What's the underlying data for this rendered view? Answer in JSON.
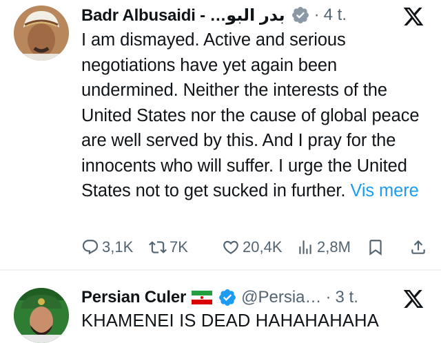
{
  "tweets": [
    {
      "author": "Badr Albusaidi - …بدر البو",
      "time": "4 t.",
      "text": "I am dismayed. Active and serious negotiations have yet again been undermined. Neither the interests of the United States nor the cause of global peace are well served by this. And I pray for the innocents who will suffer. I urge the United States not to get sucked in further.",
      "more_label": "Vis mere",
      "stats": {
        "replies": "3,1K",
        "reposts": "7K",
        "likes": "20,4K",
        "views": "2,8M"
      }
    },
    {
      "author": "Persian Culer",
      "handle": "@Persia…",
      "time": "3 t.",
      "text": "KHAMENEI IS DEAD HAHAHAHAHA"
    }
  ],
  "separator": "·",
  "colors": {
    "verified": "#1d9bf0",
    "link": "#1d9bf0",
    "muted": "#536471",
    "text": "#0f1419"
  }
}
